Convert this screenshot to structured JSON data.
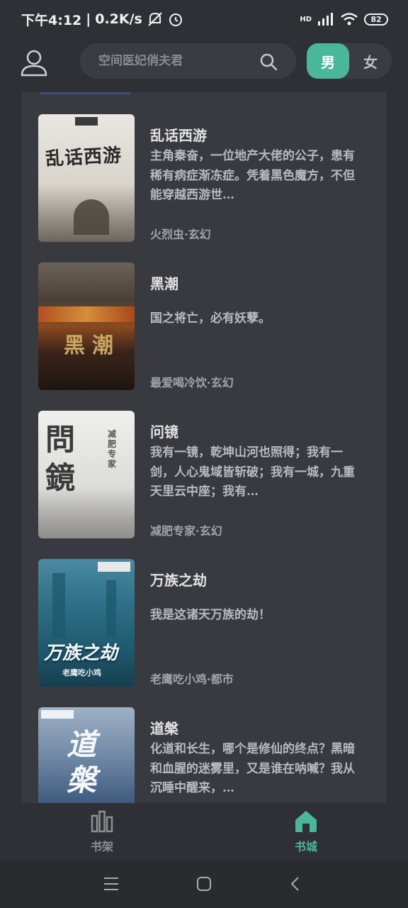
{
  "status_bar": {
    "time": "下午4:12",
    "speed": "0.2K/s",
    "network": "HD",
    "battery": "82"
  },
  "header": {
    "search_placeholder": "空间医妃俏夫君",
    "tab_male": "男",
    "tab_female": "女"
  },
  "books": [
    {
      "title": "乱话西游",
      "description": "主角秦奋，一位地产大佬的公子，患有稀有病症渐冻症。凭着黑色魔方，不但能穿越西游世…",
      "meta": "火烈虫·玄幻",
      "cover_title": "乱话西游"
    },
    {
      "title": "黑潮",
      "description": "国之将亡，必有妖孽。",
      "meta": "最爱喝冷饮·玄幻",
      "cover_title": "黑潮"
    },
    {
      "title": "问镜",
      "description": "我有一镜，乾坤山河也照得；我有一剑，人心鬼域皆斩破；我有一城，九重天里云中座；我有…",
      "meta": "减肥专家·玄幻",
      "cover_title": "問鏡",
      "cover_author": "减肥专家"
    },
    {
      "title": "万族之劫",
      "description": "我是这诸天万族的劫！",
      "meta": "老鹰吃小鸡·都市",
      "cover_title": "万族之劫",
      "cover_author": "老鹰吃小鸡"
    },
    {
      "title": "道槃",
      "description": "化道和长生，哪个是修仙的终点？黑暗和血腥的迷雾里，又是谁在呐喊？我从沉睡中醒来，…",
      "meta": "",
      "cover_title": "道槃"
    }
  ],
  "bottom_nav": {
    "bookshelf": "书架",
    "bookstore": "书城"
  },
  "colors": {
    "accent": "#4bb79a",
    "background": "#2f3035",
    "card": "#393a40"
  }
}
